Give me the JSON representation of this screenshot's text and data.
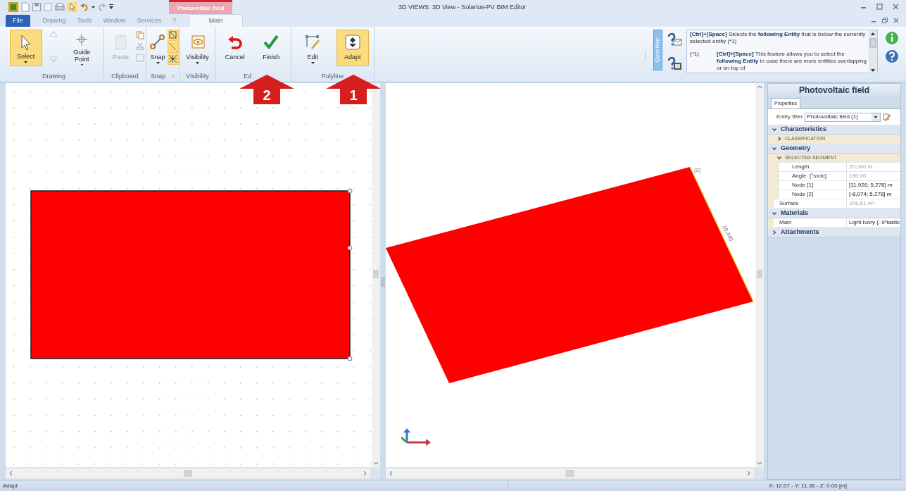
{
  "title_bar": {
    "context_group": "Photovoltaic field",
    "title": "3D VIEWS: 3D View - Solarius-PV BIM Editor"
  },
  "tabs": [
    {
      "label": "File",
      "kind": "file",
      "selected": false
    },
    {
      "label": "Drawing",
      "kind": "normal",
      "selected": false
    },
    {
      "label": "Tools",
      "kind": "normal",
      "selected": false
    },
    {
      "label": "Window",
      "kind": "normal",
      "selected": false
    },
    {
      "label": "Services",
      "kind": "normal",
      "selected": false
    },
    {
      "label": "?",
      "kind": "normal",
      "selected": false
    },
    {
      "label": "Main",
      "kind": "contextual",
      "selected": true
    }
  ],
  "ribbon": [
    {
      "label": "Drawing",
      "buttons": [
        {
          "label": "Select",
          "selected": true,
          "dropdown": true,
          "disabled": false
        },
        {
          "label": "Guide Point",
          "selected": false,
          "dropdown": true,
          "disabled": false
        }
      ]
    },
    {
      "label": "Clipboard",
      "buttons": [
        {
          "label": "Paste",
          "selected": false,
          "dropdown": false,
          "disabled": true
        }
      ]
    },
    {
      "label": "Snap",
      "buttons": [
        {
          "label": "Snap",
          "selected": false,
          "dropdown": true,
          "disabled": false
        }
      ],
      "toggles": [
        {
          "on": true
        },
        {
          "on": true
        },
        {
          "on": true
        }
      ]
    },
    {
      "label": "Visibility",
      "buttons": [
        {
          "label": "Visibility",
          "selected": false,
          "dropdown": true,
          "disabled": false
        }
      ]
    },
    {
      "label": "Ed",
      "buttons": [
        {
          "label": "Cancel",
          "selected": false,
          "dropdown": false,
          "disabled": false
        },
        {
          "label": "Finish",
          "selected": false,
          "dropdown": false,
          "disabled": false
        }
      ]
    },
    {
      "label": "Polyline",
      "buttons": [
        {
          "label": "Edit",
          "selected": false,
          "dropdown": true,
          "disabled": false
        },
        {
          "label": "Adapt",
          "selected": true,
          "dropdown": false,
          "disabled": false
        }
      ]
    }
  ],
  "quick_help": {
    "tab": "Quick Help",
    "entries": [
      {
        "text": "**[Ctrl]+[Space]** Selects the **following Entity** that is below the currently selected entity",
        "ref": "(*1)"
      },
      {
        "ref": "(*1)",
        "text": "**[Ctrl]+[Space]** This feature allows you to select the **following Entity** in case there are more entities overlapping or on top of"
      }
    ]
  },
  "right_view": {
    "node_label": "[2]",
    "edge_length": "10,440"
  },
  "annotations": [
    {
      "number": "2"
    },
    {
      "number": "1"
    }
  ],
  "properties": {
    "title": "Photovoltaic field",
    "tabs": [
      {
        "label": "Properties",
        "selected": true
      }
    ],
    "entity_filter": {
      "label": "Entity filter",
      "value": "Photovoltaic field (1)"
    },
    "categories": [
      {
        "label": "Characteristics",
        "expanded": true,
        "children": [
          {
            "label": "CLASSIFICATION",
            "kind": "subgroup",
            "expanded": false
          }
        ]
      },
      {
        "label": "Geometry",
        "expanded": true,
        "children": [
          {
            "label": "SELECTED SEGMENT",
            "kind": "subgroup",
            "expanded": true,
            "children": [
              {
                "label": "Length",
                "kind": "property",
                "value": "20,000 m",
                "readonly": true
              },
              {
                "label": "Angle  [°sxdc]",
                "kind": "property",
                "value": "180.00",
                "readonly": true
              },
              {
                "label": "Node [1]",
                "kind": "property",
                "value": "[11,926; 5,278] m",
                "readonly": false
              },
              {
                "label": "Node [2]",
                "kind": "property",
                "value": "[-8,074; 5,278] m",
                "readonly": false
              }
            ]
          },
          {
            "label": "Surface",
            "kind": "property",
            "value": "208,81 m²",
            "readonly": true
          }
        ]
      },
      {
        "label": "Materials",
        "expanded": true,
        "children": [
          {
            "label": "Main",
            "kind": "property",
            "value": "Light Ivory  (..\\Plastic",
            "readonly": false
          }
        ]
      },
      {
        "label": "Attachments",
        "expanded": false
      }
    ]
  },
  "status_bar": {
    "message": "Adapt",
    "coordinates": "X: 12.07 - Y: 11.36 - Z: 0.00 [m]"
  }
}
